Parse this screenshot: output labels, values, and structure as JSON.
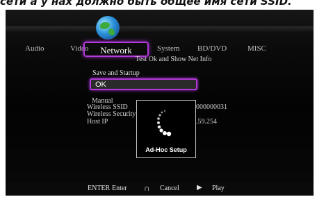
{
  "caption": "сети а у нах должно быть общее имя сети SSID.",
  "tabs": [
    "Audio",
    "Video",
    "Network",
    "System",
    "BD/DVD",
    "MISC"
  ],
  "active_tab": "Network",
  "subtitle": "Test Ok and Show Net Info",
  "section_label": "Save and Startup",
  "ok_field": "OK",
  "info_labels": [
    "Manual",
    "Wireless SSID",
    "Wireless Security",
    "Host IP"
  ],
  "info_values": [
    "000000031",
    ".59.254"
  ],
  "dialog_label": "Ad-Hoc Setup",
  "hints": {
    "enter_key": "ENTER",
    "enter_label": "Enter",
    "cancel_label": "Cancel",
    "play_label": "Play"
  },
  "colors": {
    "highlight": "#b23ad8",
    "background": "#050505",
    "text": "#d8d8d8"
  },
  "icons": [
    "globe-icon",
    "headphones-icon",
    "play-icon",
    "spinner-icon"
  ]
}
